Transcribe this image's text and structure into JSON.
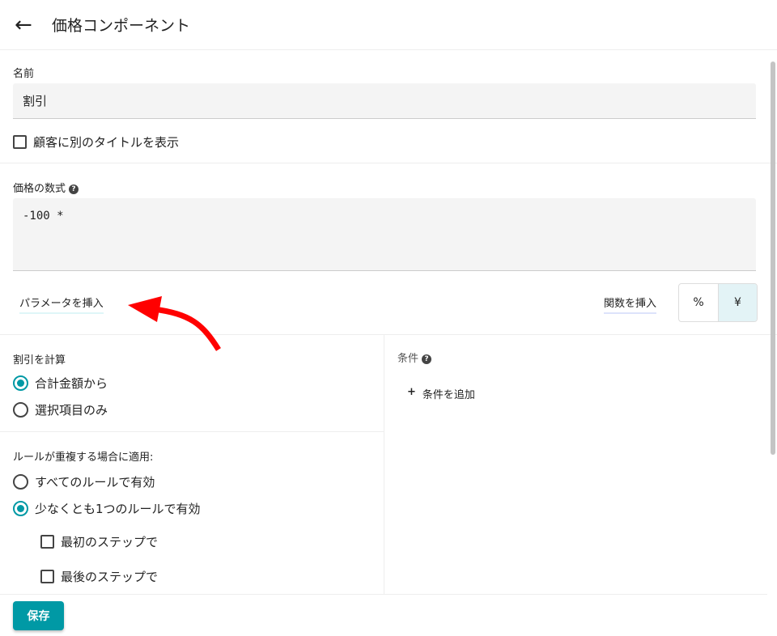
{
  "header": {
    "title": "価格コンポーネント",
    "back_icon": "arrow-left-icon"
  },
  "name": {
    "label": "名前",
    "value": "割引",
    "custom_title_label": "顧客に別のタイトルを表示",
    "custom_title_checked": false
  },
  "formula": {
    "label": "価格の数式",
    "value": "-100 *",
    "insert_param": "パラメータを挿入",
    "insert_function": "関数を挿入",
    "unit_percent": "%",
    "unit_yen": "¥",
    "selected_unit": "¥"
  },
  "calc": {
    "label": "割引を計算",
    "options": [
      "合計金額から",
      "選択項目のみ"
    ],
    "selected": 0
  },
  "overlap": {
    "label": "ルールが重複する場合に適用:",
    "options": [
      "すべてのルールで有効",
      "少なくとも1つのルールで有効"
    ],
    "selected": 1,
    "checks": [
      "最初のステップで",
      "最後のステップで"
    ]
  },
  "conditions": {
    "label": "条件",
    "add": "条件を追加"
  },
  "footer": {
    "save": "保存"
  },
  "colors": {
    "accent": "#0099a5",
    "annotation": "#ff0000"
  }
}
